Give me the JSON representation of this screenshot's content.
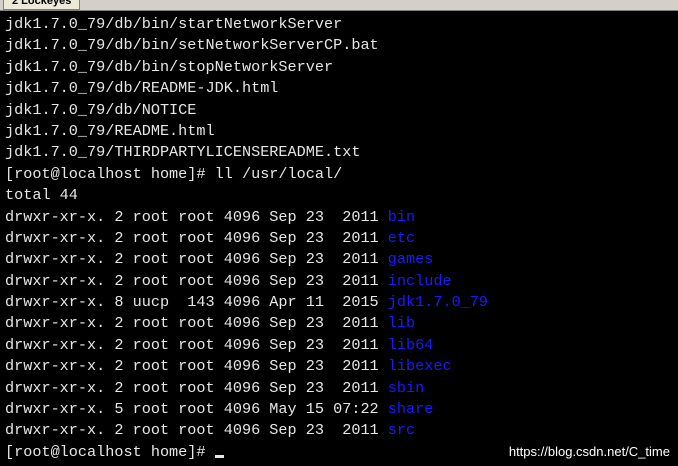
{
  "window": {
    "tab_label": "2 Lockeyes"
  },
  "terminal": {
    "output_lines": [
      "jdk1.7.0_79/db/bin/startNetworkServer",
      "jdk1.7.0_79/db/bin/setNetworkServerCP.bat",
      "jdk1.7.0_79/db/bin/stopNetworkServer",
      "jdk1.7.0_79/db/README-JDK.html",
      "jdk1.7.0_79/db/NOTICE",
      "jdk1.7.0_79/README.html",
      "jdk1.7.0_79/THIRDPARTYLICENSEREADME.txt"
    ],
    "command_line": "[root@localhost home]# ll /usr/local/",
    "total_line": "total 44",
    "listing": [
      {
        "meta": "drwxr-xr-x. 2 root root 4096 Sep 23  2011 ",
        "name": "bin"
      },
      {
        "meta": "drwxr-xr-x. 2 root root 4096 Sep 23  2011 ",
        "name": "etc"
      },
      {
        "meta": "drwxr-xr-x. 2 root root 4096 Sep 23  2011 ",
        "name": "games"
      },
      {
        "meta": "drwxr-xr-x. 2 root root 4096 Sep 23  2011 ",
        "name": "include"
      },
      {
        "meta": "drwxr-xr-x. 8 uucp  143 4096 Apr 11  2015 ",
        "name": "jdk1.7.0_79"
      },
      {
        "meta": "drwxr-xr-x. 2 root root 4096 Sep 23  2011 ",
        "name": "lib"
      },
      {
        "meta": "drwxr-xr-x. 2 root root 4096 Sep 23  2011 ",
        "name": "lib64"
      },
      {
        "meta": "drwxr-xr-x. 2 root root 4096 Sep 23  2011 ",
        "name": "libexec"
      },
      {
        "meta": "drwxr-xr-x. 2 root root 4096 Sep 23  2011 ",
        "name": "sbin"
      },
      {
        "meta": "drwxr-xr-x. 5 root root 4096 May 15 07:22 ",
        "name": "share"
      },
      {
        "meta": "drwxr-xr-x. 2 root root 4096 Sep 23  2011 ",
        "name": "src"
      }
    ],
    "prompt": "[root@localhost home]# ",
    "colors": {
      "foreground": "#e6e6e6",
      "directory": "#1a1aff",
      "background": "#000000"
    }
  },
  "watermark": "https://blog.csdn.net/C_time"
}
